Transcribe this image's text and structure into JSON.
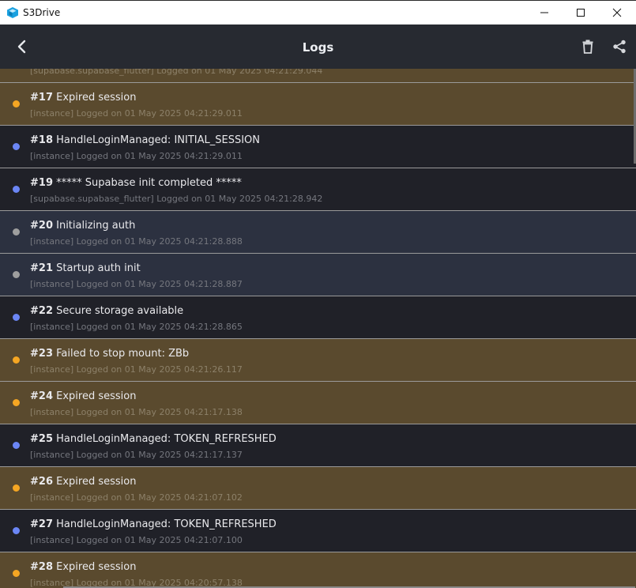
{
  "window": {
    "title": "S3Drive",
    "colors": {
      "app_icon": "#1aa1e0"
    }
  },
  "appbar": {
    "title": "Logs",
    "back_icon": "chevron-left-icon",
    "delete_icon": "trash-icon",
    "share_icon": "share-icon"
  },
  "partial_row": {
    "meta": "[supabase.supabase_flutter] Logged on 01 May 2025 04:21:29.044"
  },
  "logs": [
    {
      "num": "#17",
      "text": "Expired session",
      "meta": "[instance] Logged on 01 May 2025 04:21:29.011",
      "level": "warn"
    },
    {
      "num": "#18",
      "text": "HandleLoginManaged: INITIAL_SESSION",
      "meta": "[instance] Logged on 01 May 2025 04:21:29.011",
      "level": "info"
    },
    {
      "num": "#19",
      "text": "***** Supabase init completed *****",
      "meta": "[supabase.supabase_flutter] Logged on 01 May 2025 04:21:28.942",
      "level": "info"
    },
    {
      "num": "#20",
      "text": "Initializing auth",
      "meta": "[instance] Logged on 01 May 2025 04:21:28.888",
      "level": "debug"
    },
    {
      "num": "#21",
      "text": "Startup auth init",
      "meta": "[instance] Logged on 01 May 2025 04:21:28.887",
      "level": "debug"
    },
    {
      "num": "#22",
      "text": "Secure storage available",
      "meta": "[instance] Logged on 01 May 2025 04:21:28.865",
      "level": "info"
    },
    {
      "num": "#23",
      "text": "Failed to stop mount: ZBb",
      "meta": "[instance] Logged on 01 May 2025 04:21:26.117",
      "level": "warn"
    },
    {
      "num": "#24",
      "text": "Expired session",
      "meta": "[instance] Logged on 01 May 2025 04:21:17.138",
      "level": "warn"
    },
    {
      "num": "#25",
      "text": "HandleLoginManaged: TOKEN_REFRESHED",
      "meta": "[instance] Logged on 01 May 2025 04:21:17.137",
      "level": "info"
    },
    {
      "num": "#26",
      "text": "Expired session",
      "meta": "[instance] Logged on 01 May 2025 04:21:07.102",
      "level": "warn"
    },
    {
      "num": "#27",
      "text": "HandleLoginManaged: TOKEN_REFRESHED",
      "meta": "[instance] Logged on 01 May 2025 04:21:07.100",
      "level": "info"
    },
    {
      "num": "#28",
      "text": "Expired session",
      "meta": "[instance] Logged on 01 May 2025 04:20:57.138",
      "level": "warn"
    }
  ],
  "level_colors": {
    "warn": "#f5a623",
    "info": "#6b86f5",
    "debug": "#9e9e9e"
  }
}
